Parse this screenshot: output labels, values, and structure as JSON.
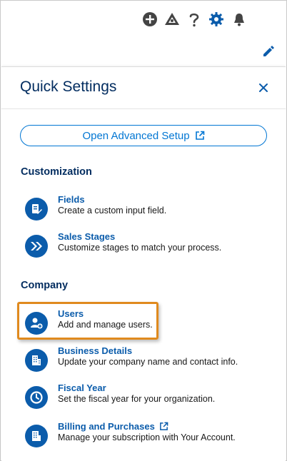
{
  "topbar": {
    "icons": [
      "add-icon",
      "trailhead-icon",
      "help-icon",
      "setup-gear-icon",
      "notifications-bell-icon"
    ],
    "edit_icon": "pencil-edit-icon"
  },
  "panel": {
    "title": "Quick Settings",
    "close_icon": "close-icon",
    "advanced_button": "Open Advanced Setup",
    "sections": {
      "customization": {
        "title": "Customization",
        "items": [
          {
            "label": "Fields",
            "desc": "Create a custom input field.",
            "icon": "fields-icon"
          },
          {
            "label": "Sales Stages",
            "desc": "Customize stages to match your process.",
            "icon": "sales-stages-icon"
          }
        ]
      },
      "company": {
        "title": "Company",
        "items": [
          {
            "label": "Users",
            "desc": "Add and manage users.",
            "icon": "users-icon",
            "highlighted": true
          },
          {
            "label": "Business Details",
            "desc": "Update your company name and contact info.",
            "icon": "building-icon"
          },
          {
            "label": "Fiscal Year",
            "desc": "Set the fiscal year for your organization.",
            "icon": "clock-icon"
          },
          {
            "label": "Billing and Purchases",
            "desc": "Manage your subscription with Your Account.",
            "icon": "billing-icon",
            "external": true
          }
        ]
      }
    }
  },
  "colors": {
    "brand_blue": "#0b5cab",
    "link_blue": "#0176d3",
    "title_navy": "#032d60",
    "highlight_orange": "#e08a1e"
  }
}
